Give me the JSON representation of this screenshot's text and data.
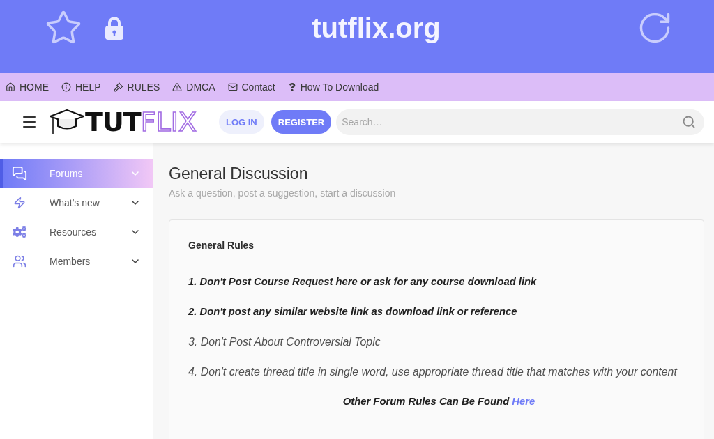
{
  "browser_bar": {
    "url": "tutflix.org"
  },
  "nav_links": [
    {
      "label": "HOME"
    },
    {
      "label": "HELP"
    },
    {
      "label": "RULES"
    },
    {
      "label": "DMCA"
    },
    {
      "label": "Contact"
    },
    {
      "label": "How To Download"
    }
  ],
  "header": {
    "logo": {
      "solid_part": "TUT",
      "outlined_part": "FLIX"
    },
    "buttons": [
      {
        "label": "LOG IN",
        "kind": "secondary"
      },
      {
        "label": "REGISTER",
        "kind": "primary"
      }
    ],
    "search": {
      "placeholder": "Search…"
    }
  },
  "sidebar": {
    "items": [
      {
        "label": "Forums",
        "selected": true
      },
      {
        "label": "What's new",
        "selected": false
      },
      {
        "label": "Resources",
        "selected": false
      },
      {
        "label": "Members",
        "selected": false
      }
    ]
  },
  "forum": {
    "title": "General Discussion",
    "description": "Ask a question, post a suggestion, start a discussion"
  },
  "notice": {
    "heading": "General Rules",
    "rules": [
      {
        "text": "1. Don't Post Course Request here or ask for any course download link",
        "bold": true
      },
      {
        "text": "2. Don't post any similar website link as download link or reference",
        "bold": true
      },
      {
        "text": "3. Don't Post About Controversial Topic",
        "bold": false
      },
      {
        "text": "4. Don't create thread title in single word, use appropriate thread title that matches with your content",
        "bold": false
      }
    ],
    "footer": {
      "text": "Other Forum Rules Can Be Found",
      "link": "Here"
    }
  }
}
